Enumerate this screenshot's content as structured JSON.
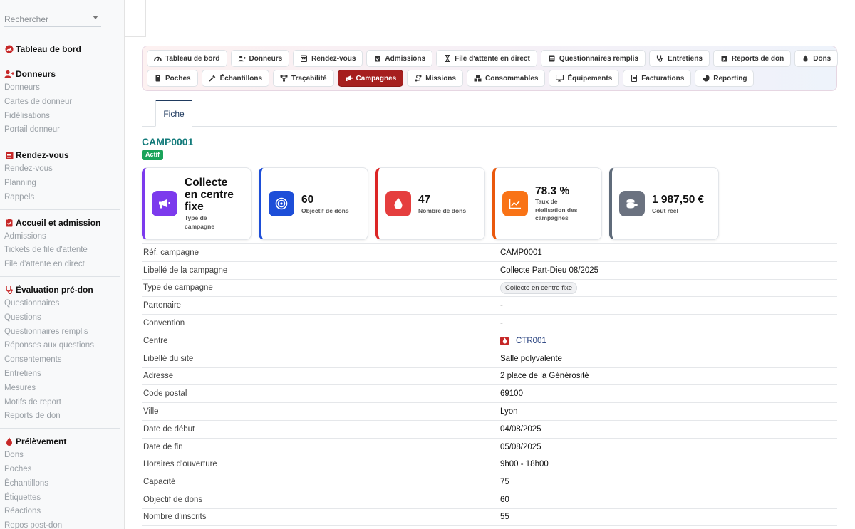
{
  "search": {
    "placeholder": "Rechercher"
  },
  "sidebar": {
    "sections": [
      {
        "title": "Tableau de bord",
        "items": []
      },
      {
        "title": "Donneurs",
        "items": [
          "Donneurs",
          "Cartes de donneur",
          "Fidélisations",
          "Portail donneur"
        ]
      },
      {
        "title": "Rendez-vous",
        "items": [
          "Rendez-vous",
          "Planning",
          "Rappels"
        ]
      },
      {
        "title": "Accueil et admission",
        "items": [
          "Admissions",
          "Tickets de file d'attente",
          "File d'attente en direct"
        ]
      },
      {
        "title": "Évaluation pré-don",
        "items": [
          "Questionnaires",
          "Questions",
          "Questionnaires remplis",
          "Réponses aux questions",
          "Consentements",
          "Entretiens",
          "Mesures",
          "Motifs de report",
          "Reports de don"
        ]
      },
      {
        "title": "Prélèvement",
        "items": [
          "Dons",
          "Poches",
          "Échantillons",
          "Étiquettes",
          "Réactions",
          "Repos post-don"
        ]
      }
    ]
  },
  "modules": {
    "row1": [
      "Tableau de bord",
      "Donneurs",
      "Rendez-vous",
      "Admissions",
      "File d'attente en direct",
      "Questionnaires remplis",
      "Entretiens",
      "Reports de don",
      "Dons"
    ],
    "row2": [
      "Poches",
      "Échantillons",
      "Traçabilité",
      "Campagnes",
      "Missions",
      "Consommables",
      "Équipements",
      "Facturations",
      "Reporting"
    ],
    "active": "Campagnes"
  },
  "tabs": {
    "fiche": "Fiche"
  },
  "campaign": {
    "code": "CAMP0001",
    "status": "Actif"
  },
  "kpis": {
    "type": {
      "value_l1": "Collecte",
      "value_l2": "en centre",
      "value_l3": "fixe",
      "label_l1": "Type de",
      "label_l2": "campagne"
    },
    "objectif": {
      "value": "60",
      "label": "Objectif de dons"
    },
    "nombre": {
      "value": "47",
      "label": "Nombre de dons"
    },
    "taux": {
      "value": "78.3 %",
      "label_l1": "Taux de",
      "label_l2": "réalisation des",
      "label_l3": "campagnes"
    },
    "cout": {
      "value": "1 987,50 €",
      "label": "Coût réel"
    }
  },
  "details": {
    "ref": {
      "label": "Réf. campagne",
      "value": "CAMP0001"
    },
    "libelle": {
      "label": "Libellé de la campagne",
      "value": "Collecte Part-Dieu 08/2025"
    },
    "type": {
      "label": "Type de campagne",
      "value": "Collecte en centre fixe"
    },
    "partenaire": {
      "label": "Partenaire",
      "value": "-"
    },
    "convention": {
      "label": "Convention",
      "value": "-"
    },
    "centre": {
      "label": "Centre",
      "value": "CTR001"
    },
    "site": {
      "label": "Libellé du site",
      "value": "Salle polyvalente"
    },
    "adresse": {
      "label": "Adresse",
      "value": "2 place de la Générosité"
    },
    "cp": {
      "label": "Code postal",
      "value": "69100"
    },
    "ville": {
      "label": "Ville",
      "value": "Lyon"
    },
    "debut": {
      "label": "Date de début",
      "value": "04/08/2025"
    },
    "fin": {
      "label": "Date de fin",
      "value": "05/08/2025"
    },
    "horaires": {
      "label": "Horaires d'ouverture",
      "value": "9h00 - 18h00"
    },
    "capacite": {
      "label": "Capacité",
      "value": "75"
    },
    "objectif": {
      "label": "Objectif de dons",
      "value": "60"
    },
    "inscrits": {
      "label": "Nombre d'inscrits",
      "value": "55"
    }
  },
  "colors": {
    "accent": "#a61e1e",
    "title": "#127a7a",
    "success": "#1aa35a"
  }
}
